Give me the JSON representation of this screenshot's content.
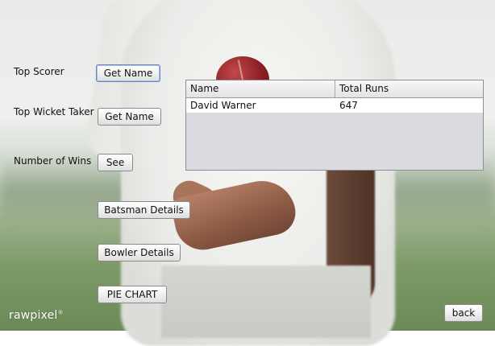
{
  "labels": {
    "top_scorer": "Top Scorer",
    "top_wicket_taker": "Top Wicket Taker",
    "number_of_wins": "Number of Wins"
  },
  "buttons": {
    "top_scorer": "Get Name",
    "top_wicket_taker": "Get Name",
    "number_of_wins": "See",
    "batsman_details": "Batsman Details",
    "bowler_details": "Bowler Details",
    "pie_chart": "PIE CHART",
    "back": "back"
  },
  "table": {
    "columns": [
      "Name",
      "Total Runs"
    ],
    "rows": [
      [
        "David Warner",
        "647"
      ]
    ]
  },
  "watermark": "rawpixel"
}
